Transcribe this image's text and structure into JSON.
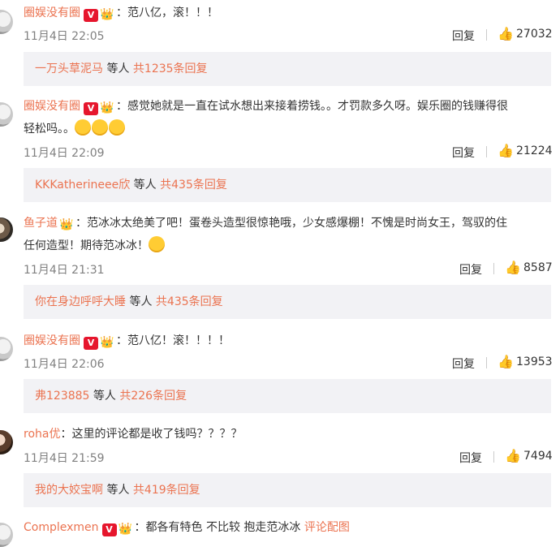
{
  "comments": [
    {
      "user": "圈娱没有圈",
      "text": "：范八亿，滚！！！",
      "time": "11月4日 22:05",
      "reply_label": "回复",
      "likes": "27032",
      "thread": {
        "user": "一万头草泥马",
        "etc": "等人",
        "count": "共1235条回复"
      }
    },
    {
      "user": "圈娱没有圈",
      "text_line1": "：感觉她就是一直在试水想出来接着捞钱。。才罚款多久呀。娱乐圈的钱赚得很",
      "text_line2": "轻松吗。。",
      "time": "11月4日 22:09",
      "reply_label": "回复",
      "likes": "21224",
      "thread": {
        "user": "KKKatherineee欣",
        "etc": "等人",
        "count": "共435条回复"
      }
    },
    {
      "user": "鱼子道",
      "text_line1": "：范冰冰太绝美了吧！蛋卷头造型很惊艳哦，少女感爆棚！不愧是时尚女王，驾驭的住",
      "text_line2": "任何造型！期待范冰冰！",
      "time": "11月4日 21:31",
      "reply_label": "回复",
      "likes": "8587",
      "thread": {
        "user": "你在身边呼呼大睡",
        "etc": "等人",
        "count": "共435条回复"
      }
    },
    {
      "user": "圈娱没有圈",
      "text": "：范八亿！滚！！！！",
      "time": "11月4日 22:06",
      "reply_label": "回复",
      "likes": "13953",
      "thread": {
        "user": "弗123885",
        "etc": "等人",
        "count": "共226条回复"
      }
    },
    {
      "user": "roha优",
      "text": "：这里的评论都是收了钱吗？？？？",
      "time": "11月4日 21:59",
      "reply_label": "回复",
      "likes": "7494",
      "thread": {
        "user": "我的大姣宝啊",
        "etc": "等人",
        "count": "共419条回复"
      }
    },
    {
      "user": "Complexmen",
      "text": "：都各有特色 不比较 抱走范冰冰",
      "link": "评论配图"
    }
  ],
  "badge_letter": "V",
  "icons": {
    "thumb": "thumbs-up-icon",
    "vip": "vip-crown-icon",
    "emoji": "smiley-emoji-icon"
  },
  "colors": {
    "name": "#eb7350",
    "meta": "#808080",
    "reply_bg": "#f2f2f5",
    "badge": "#e6162d"
  }
}
